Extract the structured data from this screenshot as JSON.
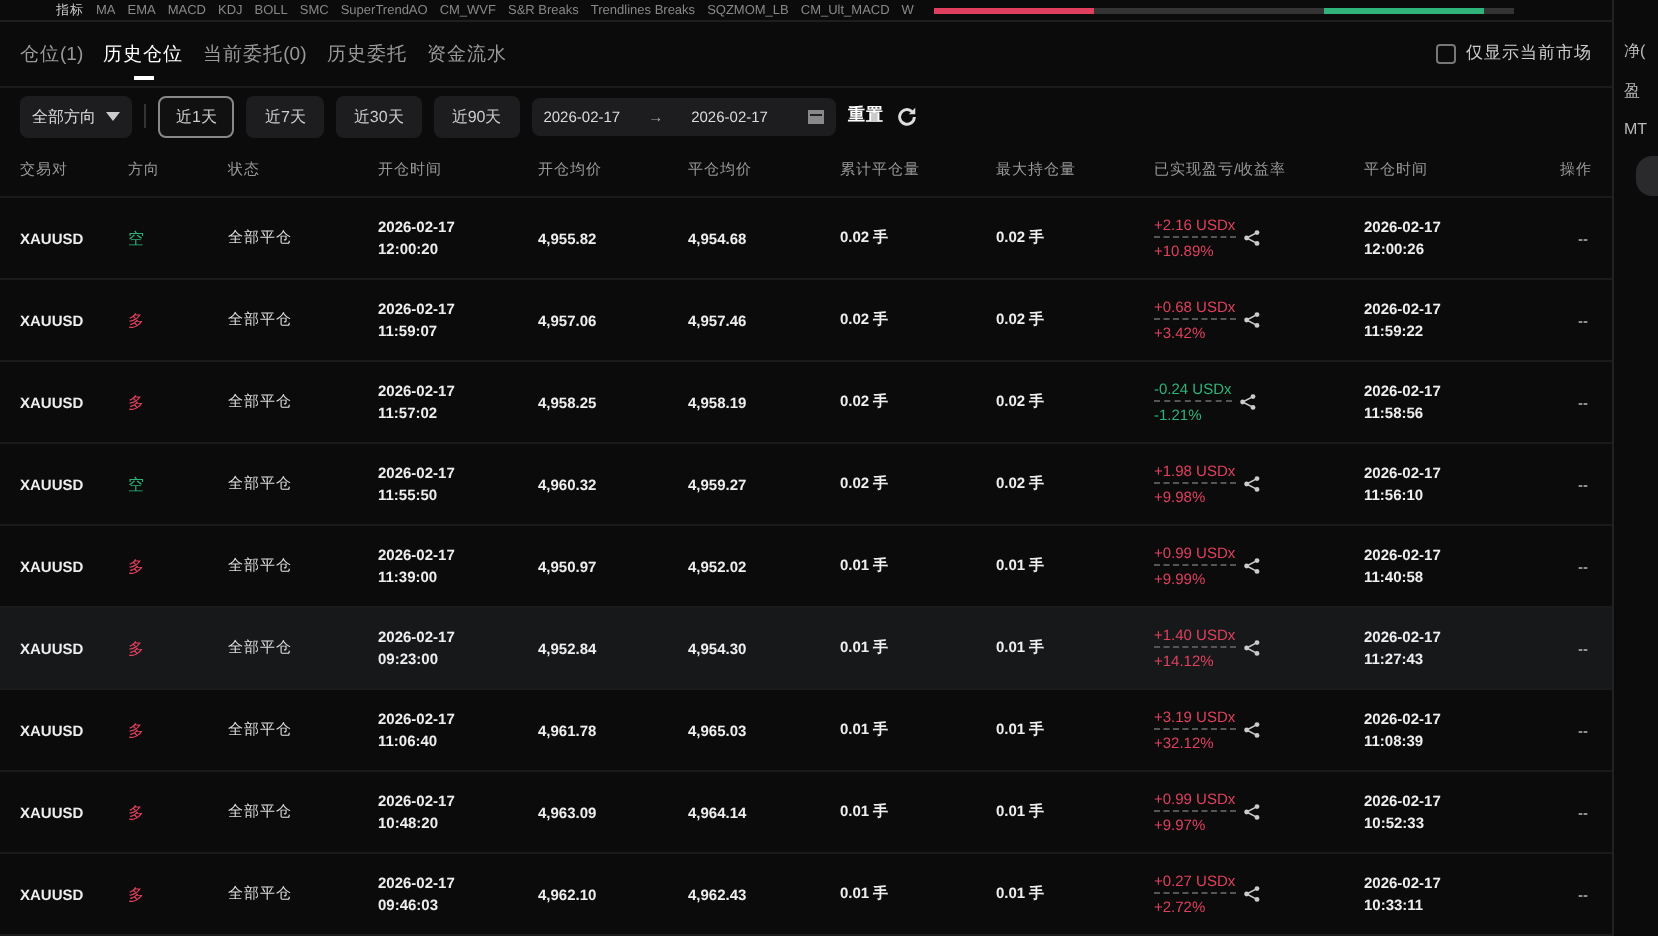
{
  "indicator_bar": {
    "label": "指标",
    "items": [
      "MA",
      "EMA",
      "MACD",
      "KDJ",
      "BOLL",
      "SMC",
      "SuperTrendAO",
      "CM_WVF",
      "S&R Breaks",
      "Trendlines Breaks",
      "SQZMOM_LB",
      "CM_Ult_MACD",
      "W"
    ]
  },
  "tabs": [
    {
      "label": "仓位(1)",
      "selected": false
    },
    {
      "label": "历史仓位",
      "selected": true
    },
    {
      "label": "当前委托(0)",
      "selected": false
    },
    {
      "label": "历史委托",
      "selected": false
    },
    {
      "label": "资金流水",
      "selected": false
    }
  ],
  "only_current_market": {
    "label": "仅显示当前市场",
    "checked": false
  },
  "filters": {
    "direction": "全部方向",
    "ranges": [
      {
        "label": "近1天",
        "selected": true
      },
      {
        "label": "近7天",
        "selected": false
      },
      {
        "label": "近30天",
        "selected": false
      },
      {
        "label": "近90天",
        "selected": false
      }
    ],
    "date_from": "2026-02-17",
    "arrow": "→",
    "date_to": "2026-02-17",
    "reset": "重置"
  },
  "table": {
    "columns": [
      "交易对",
      "方向",
      "状态",
      "开仓时间",
      "开仓均价",
      "平仓均价",
      "累计平仓量",
      "最大持仓量",
      "已实现盈亏/收益率",
      "平仓时间",
      "操作"
    ],
    "rows": [
      {
        "pair": "XAUUSD",
        "direction": "空",
        "kind": "short",
        "status": "全部平仓",
        "open_date": "2026-02-17",
        "open_time": "12:00:20",
        "open_price": "4,955.82",
        "close_price": "4,954.68",
        "closed_qty": "0.02 手",
        "max_qty": "0.02 手",
        "pnl": "+2.16 USDx",
        "color": "#e0405e",
        "rate": "+10.89%",
        "close_date": "2026-02-17",
        "close_time": "12:00:26",
        "action": "--",
        "selected": false
      },
      {
        "pair": "XAUUSD",
        "direction": "多",
        "kind": "long",
        "status": "全部平仓",
        "open_date": "2026-02-17",
        "open_time": "11:59:07",
        "open_price": "4,957.06",
        "close_price": "4,957.46",
        "closed_qty": "0.02 手",
        "max_qty": "0.02 手",
        "pnl": "+0.68 USDx",
        "color": "#e0405e",
        "rate": "+3.42%",
        "close_date": "2026-02-17",
        "close_time": "11:59:22",
        "action": "--",
        "selected": false
      },
      {
        "pair": "XAUUSD",
        "direction": "多",
        "kind": "long",
        "status": "全部平仓",
        "open_date": "2026-02-17",
        "open_time": "11:57:02",
        "open_price": "4,958.25",
        "close_price": "4,958.19",
        "closed_qty": "0.02 手",
        "max_qty": "0.02 手",
        "pnl": "-0.24 USDx",
        "color": "#2fb37a",
        "rate": "-1.21%",
        "close_date": "2026-02-17",
        "close_time": "11:58:56",
        "action": "--",
        "selected": false
      },
      {
        "pair": "XAUUSD",
        "direction": "空",
        "kind": "short",
        "status": "全部平仓",
        "open_date": "2026-02-17",
        "open_time": "11:55:50",
        "open_price": "4,960.32",
        "close_price": "4,959.27",
        "closed_qty": "0.02 手",
        "max_qty": "0.02 手",
        "pnl": "+1.98 USDx",
        "color": "#e0405e",
        "rate": "+9.98%",
        "close_date": "2026-02-17",
        "close_time": "11:56:10",
        "action": "--",
        "selected": false
      },
      {
        "pair": "XAUUSD",
        "direction": "多",
        "kind": "long",
        "status": "全部平仓",
        "open_date": "2026-02-17",
        "open_time": "11:39:00",
        "open_price": "4,950.97",
        "close_price": "4,952.02",
        "closed_qty": "0.01 手",
        "max_qty": "0.01 手",
        "pnl": "+0.99 USDx",
        "color": "#e0405e",
        "rate": "+9.99%",
        "close_date": "2026-02-17",
        "close_time": "11:40:58",
        "action": "--",
        "selected": false
      },
      {
        "pair": "XAUUSD",
        "direction": "多",
        "kind": "long",
        "status": "全部平仓",
        "open_date": "2026-02-17",
        "open_time": "09:23:00",
        "open_price": "4,952.84",
        "close_price": "4,954.30",
        "closed_qty": "0.01 手",
        "max_qty": "0.01 手",
        "pnl": "+1.40 USDx",
        "color": "#e0405e",
        "rate": "+14.12%",
        "close_date": "2026-02-17",
        "close_time": "11:27:43",
        "action": "--",
        "selected": true
      },
      {
        "pair": "XAUUSD",
        "direction": "多",
        "kind": "long",
        "status": "全部平仓",
        "open_date": "2026-02-17",
        "open_time": "11:06:40",
        "open_price": "4,961.78",
        "close_price": "4,965.03",
        "closed_qty": "0.01 手",
        "max_qty": "0.01 手",
        "pnl": "+3.19 USDx",
        "color": "#e0405e",
        "rate": "+32.12%",
        "close_date": "2026-02-17",
        "close_time": "11:08:39",
        "action": "--",
        "selected": false
      },
      {
        "pair": "XAUUSD",
        "direction": "多",
        "kind": "long",
        "status": "全部平仓",
        "open_date": "2026-02-17",
        "open_time": "10:48:20",
        "open_price": "4,963.09",
        "close_price": "4,964.14",
        "closed_qty": "0.01 手",
        "max_qty": "0.01 手",
        "pnl": "+0.99 USDx",
        "color": "#e0405e",
        "rate": "+9.97%",
        "close_date": "2026-02-17",
        "close_time": "10:52:33",
        "action": "--",
        "selected": false
      },
      {
        "pair": "XAUUSD",
        "direction": "多",
        "kind": "long",
        "status": "全部平仓",
        "open_date": "2026-02-17",
        "open_time": "09:46:03",
        "open_price": "4,962.10",
        "close_price": "4,962.43",
        "closed_qty": "0.01 手",
        "max_qty": "0.01 手",
        "pnl": "+0.27 USDx",
        "color": "#e0405e",
        "rate": "+2.72%",
        "close_date": "2026-02-17",
        "close_time": "10:33:11",
        "action": "--",
        "selected": false
      }
    ]
  },
  "side_panel": {
    "labels": [
      "净(",
      "盈",
      "MT"
    ]
  }
}
